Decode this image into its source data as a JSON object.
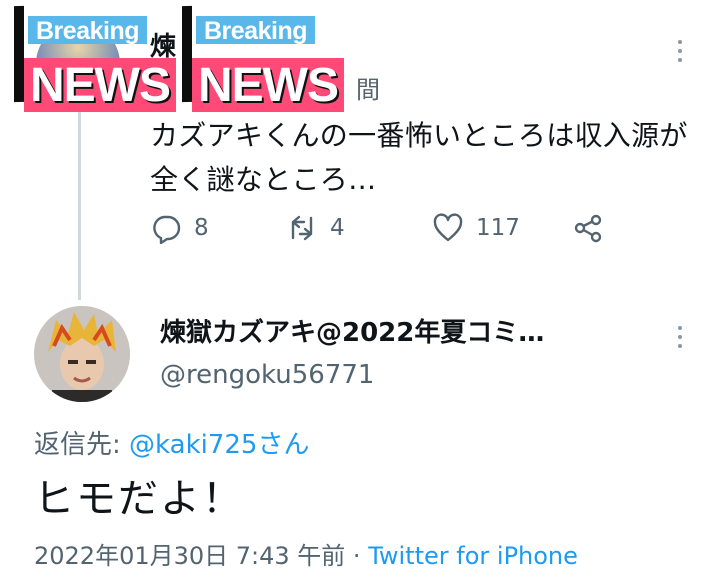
{
  "overlay": {
    "breaking": "Breaking",
    "news": "NEWS"
  },
  "parent_tweet": {
    "name_fragment": "煉",
    "handle_fragment": "間",
    "text": "カズアキくんの一番怖いところは収入源が全く謎なところ…",
    "reply_count": "8",
    "retweet_count": "4",
    "like_count": "117"
  },
  "tweet": {
    "display_name": "煉獄カズアキ@2022年夏コミ…",
    "handle": "@rengoku56771",
    "reply_to_label": "返信先: ",
    "reply_to_mention": "@kaki725さん",
    "text": "ヒモだよ！",
    "timestamp": "2022年01月30日 7:43 午前 · ",
    "source": "Twitter for iPhone"
  },
  "icons": {
    "reply": "speech-bubble-icon",
    "retweet": "retweet-arrows-icon",
    "like": "heart-icon",
    "share": "share-nodes-icon",
    "more": "vertical-dots-icon"
  },
  "colors": {
    "link": "#1d9bf0",
    "secondary_text": "#536471",
    "breaking_bg": "#59b7ea",
    "news_bg": "#ff4a78"
  }
}
